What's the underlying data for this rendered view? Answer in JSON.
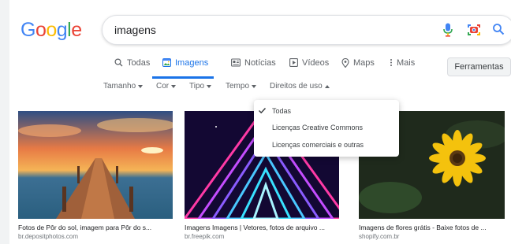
{
  "logo": {
    "letters": [
      "G",
      "o",
      "o",
      "g",
      "l",
      "e"
    ],
    "colors": [
      "#4285f4",
      "#ea4335",
      "#fbbc05",
      "#4285f4",
      "#34a853",
      "#ea4335"
    ]
  },
  "search": {
    "query": "imagens"
  },
  "icons": {
    "mic": "mic-icon",
    "camera": "camera-icon",
    "search": "search-icon"
  },
  "tabs": [
    {
      "label": "Todas",
      "icon": "search-icon",
      "active": false
    },
    {
      "label": "Imagens",
      "icon": "image-icon",
      "active": true
    },
    {
      "label": "Notícias",
      "icon": "news-icon",
      "active": false
    },
    {
      "label": "Vídeos",
      "icon": "video-icon",
      "active": false
    },
    {
      "label": "Maps",
      "icon": "map-pin-icon",
      "active": false
    },
    {
      "label": "Mais",
      "icon": "more-icon",
      "active": false
    }
  ],
  "tools_label": "Ferramentas",
  "filters": [
    {
      "label": "Tamanho"
    },
    {
      "label": "Cor"
    },
    {
      "label": "Tipo"
    },
    {
      "label": "Tempo"
    },
    {
      "label": "Direitos de uso",
      "open": true
    }
  ],
  "dropdown": {
    "options": [
      "Todas",
      "Licenças Creative Commons",
      "Licenças comerciais e outras"
    ],
    "selected": 0
  },
  "results": [
    {
      "title": "Fotos de Pôr do sol, imagem para Pôr do s...",
      "source": "br.depositphotos.com"
    },
    {
      "title": "Imagens Imagens | Vetores, fotos de arquivo ...",
      "source": "br.freepik.com"
    },
    {
      "title": "Imagens de flores grátis - Baixe fotos de ...",
      "source": "shopify.com.br"
    }
  ],
  "colors": {
    "accent": "#1a73e8",
    "muted": "#5f6368"
  }
}
